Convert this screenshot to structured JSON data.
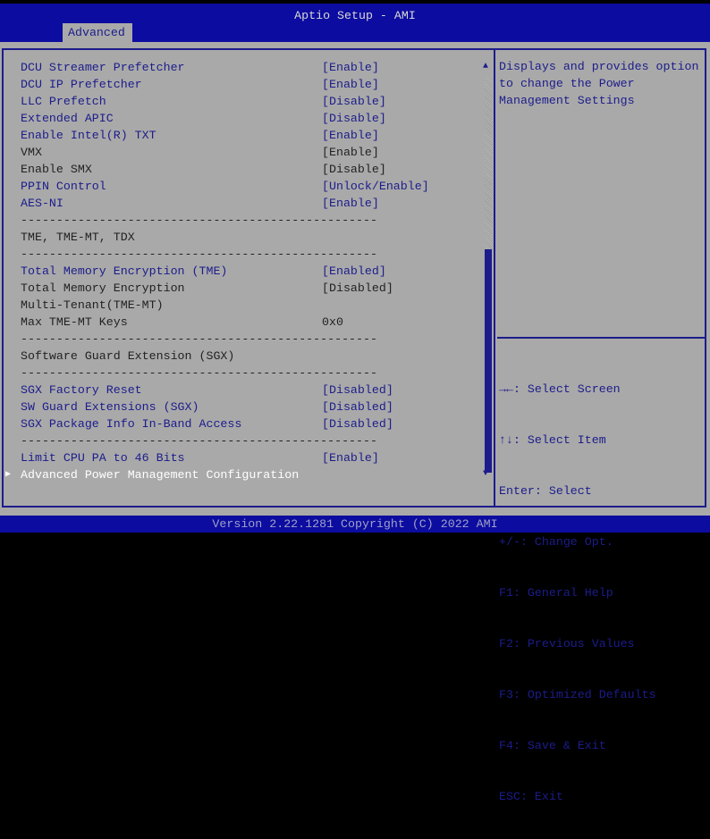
{
  "header": {
    "title": "Aptio Setup - AMI",
    "tab": "Advanced"
  },
  "items": [
    {
      "label": "DCU Streamer Prefetcher",
      "value": "[Enable]",
      "style": "blue"
    },
    {
      "label": "DCU IP Prefetcher",
      "value": "[Enable]",
      "style": "blue"
    },
    {
      "label": "LLC Prefetch",
      "value": "[Disable]",
      "style": "blue"
    },
    {
      "label": "Extended APIC",
      "value": "[Disable]",
      "style": "blue"
    },
    {
      "label": "Enable Intel(R) TXT",
      "value": "[Enable]",
      "style": "blue"
    },
    {
      "label": "VMX",
      "value": "[Enable]",
      "style": "dark"
    },
    {
      "label": "Enable SMX",
      "value": "[Disable]",
      "style": "dark"
    },
    {
      "label": "PPIN Control",
      "value": "[Unlock/Enable]",
      "style": "blue"
    },
    {
      "label": "AES-NI",
      "value": "[Enable]",
      "style": "blue"
    },
    {
      "label": "--------------------------------------------------",
      "value": "",
      "style": "dark"
    },
    {
      "label": "TME, TME-MT, TDX",
      "value": "",
      "style": "dark"
    },
    {
      "label": "--------------------------------------------------",
      "value": "",
      "style": "dark"
    },
    {
      "label": "Total Memory Encryption (TME)",
      "value": "[Enabled]",
      "style": "blue"
    },
    {
      "label": "Total Memory Encryption",
      "value": "[Disabled]",
      "style": "dark"
    },
    {
      "label": "Multi-Tenant(TME-MT)",
      "value": "",
      "style": "dark"
    },
    {
      "label": "Max TME-MT Keys",
      "value": "0x0",
      "style": "dark"
    },
    {
      "label": "--------------------------------------------------",
      "value": "",
      "style": "dark"
    },
    {
      "label": "Software Guard Extension (SGX)",
      "value": "",
      "style": "dark"
    },
    {
      "label": "--------------------------------------------------",
      "value": "",
      "style": "dark"
    },
    {
      "label": "SGX Factory Reset",
      "value": "[Disabled]",
      "style": "blue"
    },
    {
      "label": "SW Guard Extensions (SGX)",
      "value": "[Disabled]",
      "style": "blue"
    },
    {
      "label": "SGX Package Info In-Band Access",
      "value": "[Disabled]",
      "style": "blue"
    },
    {
      "label": "--------------------------------------------------",
      "value": "",
      "style": "dark"
    },
    {
      "label": "Limit CPU PA to 46 Bits",
      "value": "[Enable]",
      "style": "blue"
    },
    {
      "label": "Advanced Power Management Configuration",
      "value": "",
      "style": "selected"
    }
  ],
  "help": {
    "text": "Displays and provides option to change the Power Management Settings"
  },
  "keys": [
    "→←: Select Screen",
    "↑↓: Select Item",
    "Enter: Select",
    "+/-: Change Opt.",
    "F1: General Help",
    "F2: Previous Values",
    "F3: Optimized Defaults",
    "F4: Save & Exit",
    "ESC: Exit"
  ],
  "footer": "Version 2.22.1281 Copyright (C) 2022 AMI"
}
